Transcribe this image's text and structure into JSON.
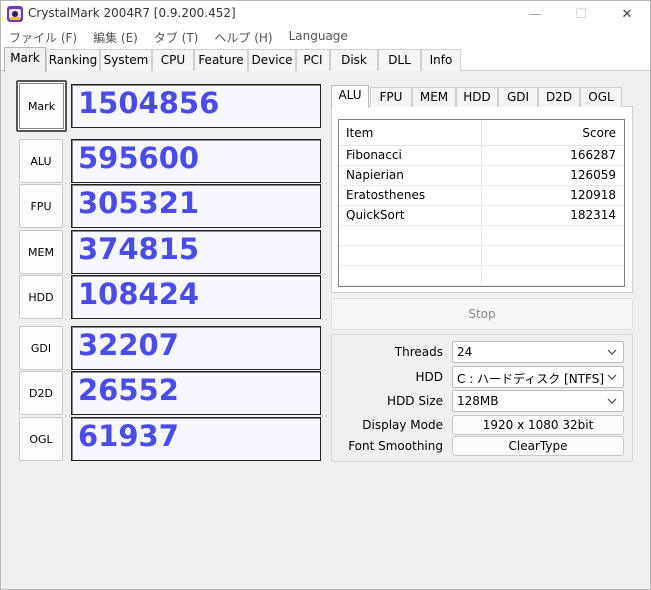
{
  "window": {
    "title": "CrystalMark 2004R7 [0.9.200.452]",
    "minimize_glyph": "—",
    "maximize_glyph": "☐",
    "close_glyph": "✕"
  },
  "menu": [
    "ファイル (F)",
    "編集 (E)",
    "タブ (T)",
    "ヘルプ (H)",
    "Language"
  ],
  "main_tabs": [
    "Mark",
    "Ranking",
    "System",
    "CPU",
    "Feature",
    "Device",
    "PCI",
    "Disk",
    "DLL",
    "Info"
  ],
  "main_tab_active": "Mark",
  "scores": [
    {
      "label": "Mark",
      "value": "1504856"
    },
    {
      "label": "ALU",
      "value": "595600"
    },
    {
      "label": "FPU",
      "value": "305321"
    },
    {
      "label": "MEM",
      "value": "374815"
    },
    {
      "label": "HDD",
      "value": "108424"
    },
    {
      "label": "GDI",
      "value": "32207"
    },
    {
      "label": "D2D",
      "value": "26552"
    },
    {
      "label": "OGL",
      "value": "61937"
    }
  ],
  "sub_tabs": [
    "ALU",
    "FPU",
    "MEM",
    "HDD",
    "GDI",
    "D2D",
    "OGL"
  ],
  "sub_tab_active": "ALU",
  "list": {
    "columns": [
      "Item",
      "Score"
    ],
    "rows": [
      {
        "item": "Fibonacci",
        "score": "166287"
      },
      {
        "item": "Napierian",
        "score": "126059"
      },
      {
        "item": "Eratosthenes",
        "score": "120918"
      },
      {
        "item": "QuickSort",
        "score": "182314"
      }
    ]
  },
  "stop_label": "Stop",
  "settings": {
    "threads_label": "Threads",
    "threads_value": "24",
    "hdd_label": "HDD",
    "hdd_value": "C : ハードディスク [NTFS]",
    "hdd_size_label": "HDD Size",
    "hdd_size_value": "128MB",
    "display_mode_label": "Display Mode",
    "display_mode_value": "1920 x 1080 32bit",
    "font_smoothing_label": "Font Smoothing",
    "font_smoothing_value": "ClearType"
  },
  "colors": {
    "score_text": "#4b4be8",
    "window_bg": "#f0f0f0"
  },
  "icons": {
    "app": "crystalmark-app-icon",
    "dropdown": "chevron-down-icon"
  }
}
